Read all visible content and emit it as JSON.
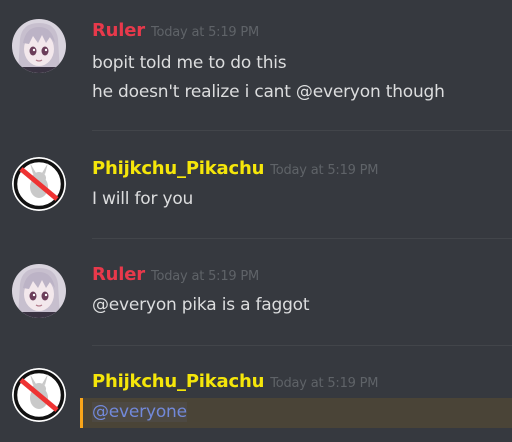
{
  "colors": {
    "background": "#36393f",
    "ruler_name": "#e8394b",
    "pikachu_name": "#f5e60a",
    "message_text": "#dcddde",
    "timestamp": "#5f6368",
    "mention": "#7289da",
    "mention_highlight_border": "#faa61a"
  },
  "messages": [
    {
      "username": "Ruler",
      "timestamp": "Today at 5:19 PM",
      "avatar_icon": "anime-girl-avatar-icon",
      "lines": [
        "bopit told me to do this",
        "he doesn't realize i cant @everyon though"
      ]
    },
    {
      "username": "Phijkchu_Pikachu",
      "timestamp": "Today at 5:19 PM",
      "avatar_icon": "no-pikachu-avatar-icon",
      "lines": [
        "I will for you"
      ]
    },
    {
      "username": "Ruler",
      "timestamp": "Today at 5:19 PM",
      "avatar_icon": "anime-girl-avatar-icon",
      "lines": [
        "@everyon pika is a faggot"
      ]
    },
    {
      "username": "Phijkchu_Pikachu",
      "timestamp": "Today at 5:19 PM",
      "avatar_icon": "no-pikachu-avatar-icon",
      "lines": [
        "@everyone"
      ]
    }
  ]
}
